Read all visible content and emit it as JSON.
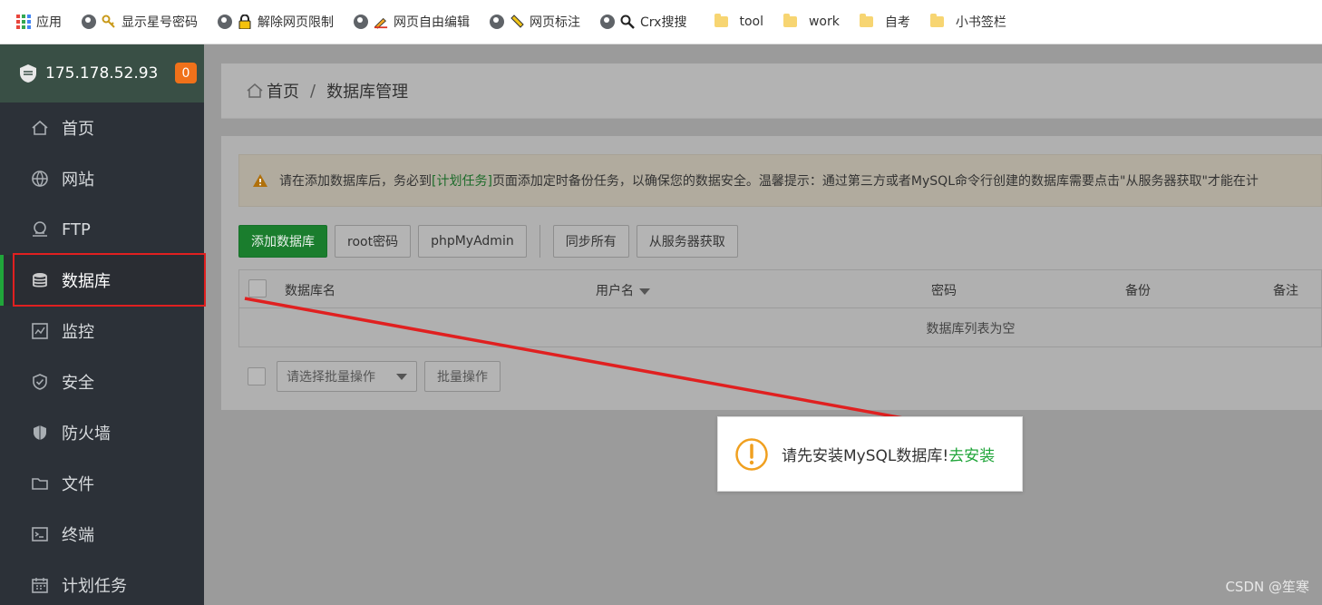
{
  "bookmarks": [
    {
      "label": "应用",
      "icon": "apps-grid-icon"
    },
    {
      "label": "显示星号密码",
      "icon": "key-icon"
    },
    {
      "label": "解除网页限制",
      "icon": "lock-icon"
    },
    {
      "label": "网页自由编辑",
      "icon": "pencil-icon"
    },
    {
      "label": "网页标注",
      "icon": "ruler-icon"
    },
    {
      "label": "Crx搜搜",
      "icon": "magnifier-icon"
    },
    {
      "label": "tool",
      "icon": "folder-icon"
    },
    {
      "label": "work",
      "icon": "folder-icon"
    },
    {
      "label": "自考",
      "icon": "folder-icon"
    },
    {
      "label": "小书签栏",
      "icon": "folder-icon"
    }
  ],
  "sidebar": {
    "server_ip": "175.178.52.93",
    "badge_count": "0",
    "items": [
      {
        "label": "首页",
        "icon": "home-icon"
      },
      {
        "label": "网站",
        "icon": "globe-icon"
      },
      {
        "label": "FTP",
        "icon": "ftp-icon"
      },
      {
        "label": "数据库",
        "icon": "database-icon",
        "active": true
      },
      {
        "label": "监控",
        "icon": "monitor-icon"
      },
      {
        "label": "安全",
        "icon": "shield-check-icon"
      },
      {
        "label": "防火墙",
        "icon": "firewall-icon"
      },
      {
        "label": "文件",
        "icon": "folder-icon"
      },
      {
        "label": "终端",
        "icon": "terminal-icon"
      },
      {
        "label": "计划任务",
        "icon": "calendar-icon"
      }
    ]
  },
  "breadcrumb": {
    "home": "首页",
    "separator": "/",
    "current": "数据库管理"
  },
  "alert": {
    "prefix": "请在添加数据库后，务必到",
    "link": "[计划任务]",
    "suffix": "页面添加定时备份任务，以确保您的数据安全。温馨提示：通过第三方或者MySQL命令行创建的数据库需要点击\"从服务器获取\"才能在计"
  },
  "toolbar": {
    "add_db": "添加数据库",
    "root_password": "root密码",
    "phpmyadmin": "phpMyAdmin",
    "sync_all": "同步所有",
    "fetch_from_server": "从服务器获取"
  },
  "table": {
    "columns": [
      "数据库名",
      "用户名",
      "密码",
      "备份",
      "备注"
    ],
    "empty_text": "数据库列表为空"
  },
  "batch": {
    "select_placeholder": "请选择批量操作",
    "button": "批量操作"
  },
  "toast": {
    "message": "请先安装MySQL数据库!",
    "link": "去安装"
  },
  "watermark": "CSDN @笙寒",
  "colors": {
    "brand_green": "#20a53a",
    "annotation_red": "#e02020",
    "badge_orange": "#f0711a",
    "sidebar_bg": "#2c3138"
  }
}
